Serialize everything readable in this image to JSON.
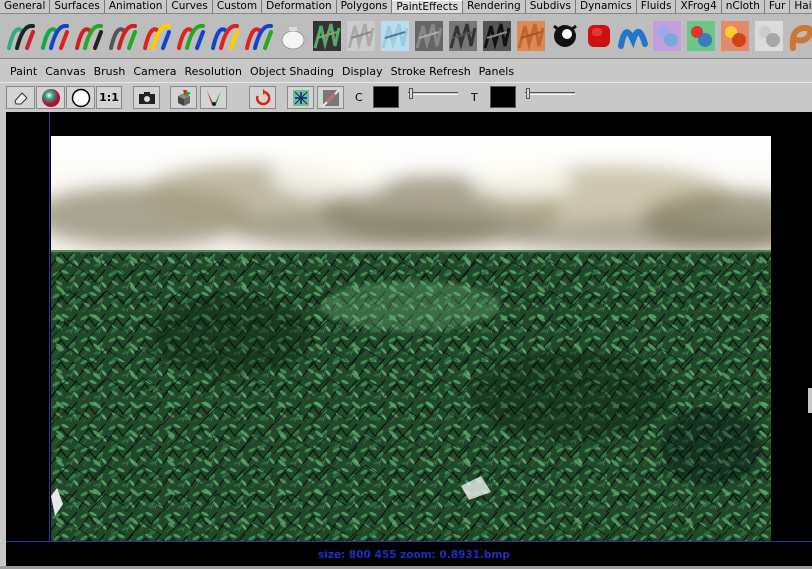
{
  "shelf_tabs": [
    "General",
    "Surfaces",
    "Animation",
    "Curves",
    "Custom",
    "Deformation",
    "Polygons",
    "PaintEffects",
    "Rendering",
    "Subdivs",
    "Dynamics",
    "Fluids",
    "XFrog4",
    "nCloth",
    "Fur",
    "Hai"
  ],
  "active_tab": "PaintEffects",
  "shelf_icons": [
    "paint-tool-icon",
    "brush-swirl-icon",
    "brushes-v-icon",
    "paint-cube-icon",
    "stroke-rainbow-icon",
    "stroke-rainbow-icon",
    "stroke-rainbow-icon",
    "stroke-rainbow-icon",
    "teapot-icon",
    "trees-icon",
    "smoke-icon",
    "crystals-icon",
    "figure-icon",
    "branches-icon",
    "ink-strokes-icon",
    "hair-icon",
    "swirl-dark-icon",
    "red-blob-icon",
    "blue-wave-icon",
    "glitter-icon",
    "rainbow-swirl-icon",
    "flames-icon",
    "mesh-icon",
    "curl-icon",
    "sphere-icon"
  ],
  "menu": [
    "Paint",
    "Canvas",
    "Brush",
    "Camera",
    "Resolution",
    "Object Shading",
    "Display",
    "Stroke Refresh",
    "Panels"
  ],
  "toolbar": {
    "one_to_one": "1:1",
    "c_label": "C",
    "t_label": "T"
  },
  "status": "size:  800  455 zoom: 0.8931.bmp",
  "colors": {
    "status_text": "#1a2fc8",
    "guide_line": "#1a3aa8",
    "foliage": "#2f6a3a"
  }
}
